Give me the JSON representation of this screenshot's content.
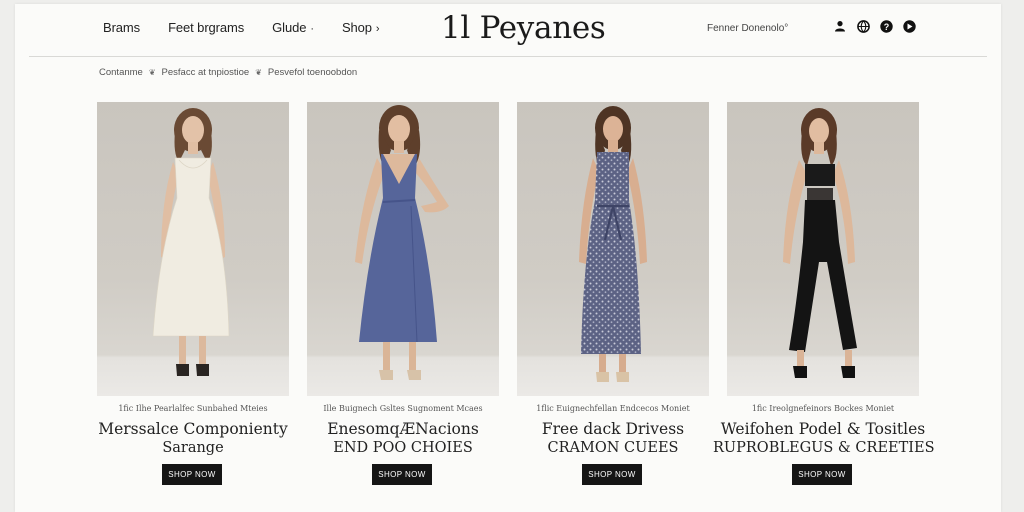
{
  "header": {
    "nav": [
      "Brams",
      "Feet brgrams",
      "Glude",
      "Shop"
    ],
    "shop_arrow": "›",
    "glude_dot": "·",
    "logo": "1l Peyanes",
    "account_link": "Fenner Donenolo°",
    "icons": [
      "user-icon",
      "globe-icon",
      "help-icon",
      "cart-icon"
    ]
  },
  "breadcrumb": [
    "Contanme",
    "Pesfacc at tnpiostioe",
    "Pesvefol toenoobdon"
  ],
  "breadcrumb_separator": "❦",
  "products": [
    {
      "tagline": "1fic Ilhe Pearlalfec Sunbahed Mteies",
      "title_line1": "Merssalce Componienty",
      "title_line2": "Sarange",
      "button": "SHOP NOW",
      "garment_color": "#f0ece1"
    },
    {
      "tagline": "Ille Buignech Gsltes Sugnoment Mcaes",
      "title_line1": "EnesomqÆNacions",
      "title_line2": "END POO CHOIES",
      "button": "SHOP NOW",
      "garment_color": "#56659a"
    },
    {
      "tagline": "1flic Euignechfellan Endcecos Moniet",
      "title_line1": "Free dack Drivess",
      "title_line2": "CRAMON CUEES",
      "button": "SHOP NOW",
      "garment_color": "#5c6284"
    },
    {
      "tagline": "1fic Ireolgnefeinors Bockes Moniet",
      "title_line1": "Weifohen Podel & Tositles",
      "title_line2": "RUPROBLEGUS & CREETIES",
      "button": "SHOP NOW",
      "garment_color": "#141414"
    }
  ]
}
